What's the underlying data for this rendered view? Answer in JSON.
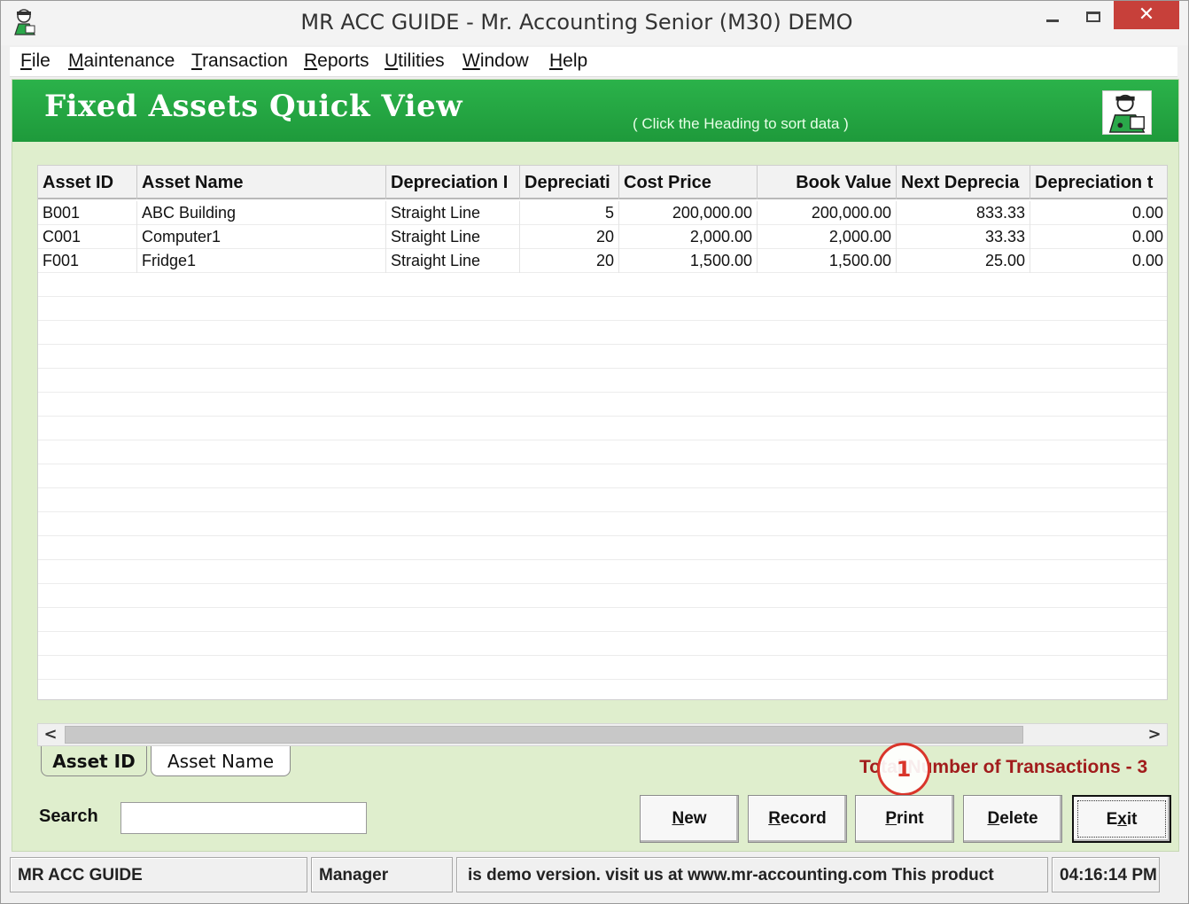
{
  "window": {
    "title": "MR ACC GUIDE - Mr. Accounting Senior (M30) DEMO",
    "close_glyph": "✕"
  },
  "menu": [
    {
      "key": "F",
      "rest": "ile"
    },
    {
      "key": "M",
      "rest": "aintenance"
    },
    {
      "key": "T",
      "rest": "ransaction"
    },
    {
      "key": "R",
      "rest": "eports"
    },
    {
      "key": "U",
      "rest": "tilities"
    },
    {
      "key": "W",
      "rest": "indow"
    },
    {
      "key": "H",
      "rest": "elp"
    }
  ],
  "banner": {
    "title": "Fixed Assets Quick View",
    "hint": "( Click the Heading to sort data )"
  },
  "grid": {
    "columns": [
      "Asset ID",
      "Asset Name",
      "Depreciation I",
      "Depreciati",
      "Cost Price",
      "Book Value",
      "Next Deprecia",
      "Depreciation t"
    ],
    "rows": [
      [
        "B001",
        "ABC Building",
        "Straight Line",
        "5",
        "200,000.00",
        "200,000.00",
        "833.33",
        "0.00"
      ],
      [
        "C001",
        "Computer1",
        "Straight Line",
        "20",
        "2,000.00",
        "2,000.00",
        "33.33",
        "0.00"
      ],
      [
        "F001",
        "Fridge1",
        "Straight Line",
        "20",
        "1,500.00",
        "1,500.00",
        "25.00",
        "0.00"
      ]
    ]
  },
  "scroll": {
    "left_arrow": "<",
    "right_arrow": ">"
  },
  "tabs": {
    "asset_id": "Asset ID",
    "asset_name": "Asset Name"
  },
  "total_label": "Total Number of Transactions - 3",
  "step_badge": "1",
  "search": {
    "label": "Search",
    "value": ""
  },
  "buttons": {
    "new": {
      "key": "N",
      "rest": "ew"
    },
    "record": {
      "key": "R",
      "rest": "ecord"
    },
    "print": {
      "key": "P",
      "rest": "rint"
    },
    "delete": {
      "key": "D",
      "rest": "elete"
    },
    "exit": {
      "pre": "E",
      "key": "x",
      "rest": "it"
    }
  },
  "status": {
    "app": "MR ACC GUIDE",
    "user": "Manager",
    "message": "is demo version.  visit us at www.mr-accounting.com This product",
    "time": "04:16:14 PM"
  },
  "colors": {
    "banner_green": "#1e9a3b",
    "panel_bg": "#dfeecd",
    "total_red": "#a11c1c",
    "close_red": "#c7403a"
  }
}
